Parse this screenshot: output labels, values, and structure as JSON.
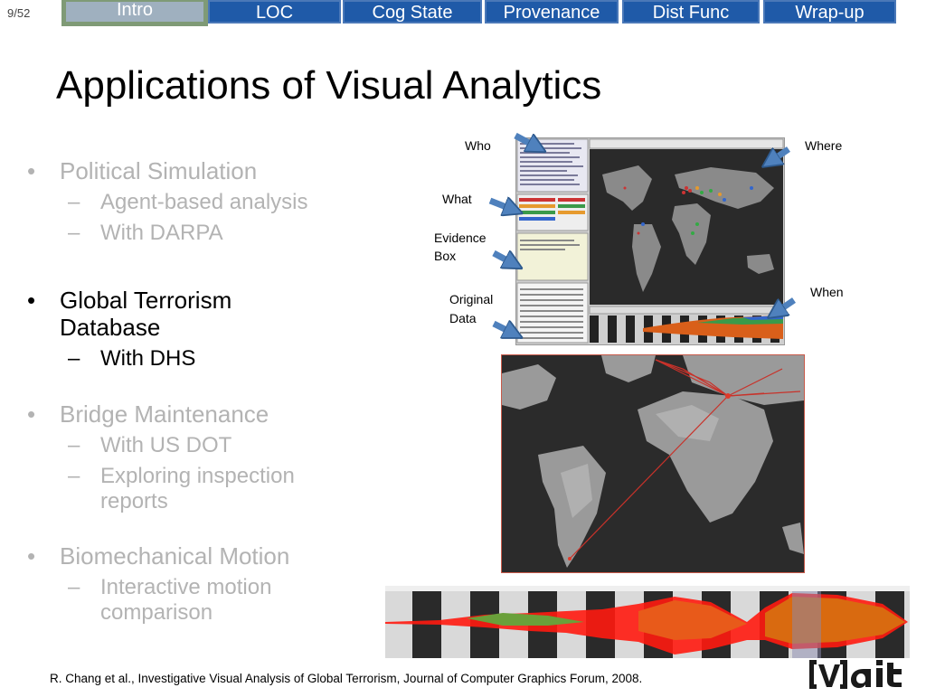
{
  "slide": {
    "page_number": "9/52"
  },
  "nav_tabs": [
    {
      "label": "Intro",
      "active": true
    },
    {
      "label": "LOC",
      "active": false
    },
    {
      "label": "Cog State",
      "active": false
    },
    {
      "label": "Provenance",
      "active": false
    },
    {
      "label": "Dist Func",
      "active": false
    },
    {
      "label": "Wrap-up",
      "active": false
    }
  ],
  "title": "Applications of Visual Analytics",
  "bullets": [
    {
      "text": "Political Simulation",
      "subs": [
        "Agent-based analysis",
        "With DARPA"
      ]
    },
    {
      "text": "Global Terrorism",
      "text2": "Database",
      "subs": [
        "With DHS"
      ]
    },
    {
      "text": "Bridge Maintenance",
      "subs": [
        "With US DOT",
        "Exploring inspection",
        "reports"
      ]
    },
    {
      "text": "Biomechanical Motion",
      "subs": [
        "Interactive motion",
        "comparison"
      ]
    }
  ],
  "callouts": {
    "who": "Who",
    "where": "Where",
    "what": "What",
    "evidence_1": "Evidence",
    "evidence_2": "Box",
    "when": "When",
    "original_1": "Original",
    "original_2": "Data"
  },
  "citation": "R. Chang et al., Investigative Visual Analysis of Global Terrorism, Journal of Computer Graphics Forum, 2008.",
  "logo": "[V]ait",
  "colors": {
    "tab_bg": "#1f5aa8",
    "active_tab": "#9fb0bf",
    "dim_text": "#b3b3b3",
    "arrow": "#4f81bd"
  }
}
